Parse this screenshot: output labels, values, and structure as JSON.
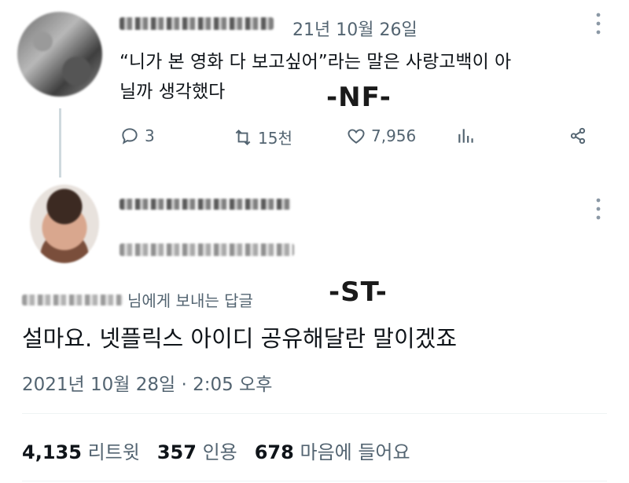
{
  "original_tweet": {
    "display_name": "",
    "date": "21년 10월 26일",
    "text_line1": "“니가 본 영화 다 보고싶어”라는 말은 사랑고백이 아",
    "text_line2": "닐까 생각했다",
    "actions": {
      "replies": "3",
      "retweets": "15천",
      "likes": "7,956"
    }
  },
  "watermarks": {
    "first": "-NF-",
    "second": "-ST-"
  },
  "reply_tweet": {
    "reply_to_suffix": "님에게 보내는 답글",
    "text": "설마요. 넷플릭스 아이디 공유해달란 말이겠죠",
    "timestamp": "2021년 10월 28일 · 2:05 오후"
  },
  "stats": {
    "retweets_count": "4,135",
    "retweets_label": "리트윗",
    "quotes_count": "357",
    "quotes_label": "인용",
    "likes_count": "678",
    "likes_label": "마음에 들어요"
  },
  "icons": [
    "more-icon",
    "reply-icon",
    "retweet-icon",
    "like-icon",
    "analytics-icon",
    "share-icon"
  ],
  "colors": {
    "muted": "#536471",
    "text": "#0f1419",
    "divider": "#eff3f4"
  }
}
